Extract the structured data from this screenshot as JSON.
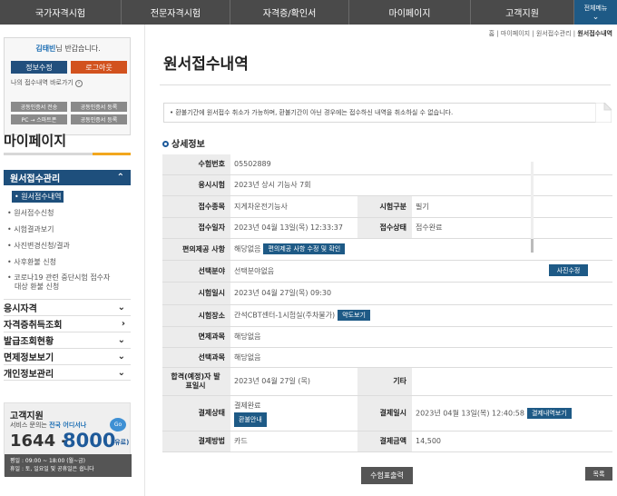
{
  "topnav": {
    "tabs": [
      "국가자격시험",
      "전문자격시험",
      "자격증/확인서",
      "마이페이지",
      "고객지원"
    ],
    "all_menu": "전체메뉴"
  },
  "user": {
    "name": "김태빈",
    "greeting_suffix": "님 반갑습니다.",
    "info_button": "정보수정",
    "logout_button": "로그아웃",
    "quick_link": "나의 접수내역 바로가기",
    "cert_buttons": [
      "공동인증서 전송",
      "공동인증서 등록",
      "PC → 스마트폰",
      "공동인증서 등록"
    ]
  },
  "sidebar": {
    "title": "마이페이지",
    "section": "원서접수관리",
    "subitems": [
      "원서접수내역",
      "원서접수신청",
      "시험결과보기",
      "사진변경신청/결과",
      "사후환불 신청"
    ],
    "corona_line1": "코로나19 관련 중단시험 접수자",
    "corona_line2": "대상 환불 신청",
    "menus": [
      "응시자격",
      "자격증취득조회",
      "발급조회현황",
      "면제정보보기",
      "개인정보관리"
    ]
  },
  "support": {
    "title": "고객지원",
    "sub_prefix": "서비스 문의는 ",
    "sub_hl": "전국 어디서나",
    "bubble": "Go",
    "phone1": "1644 -",
    "phone2": "8000",
    "phone3": "(유료)",
    "hours1": "평일 : 09:00 ~ 18:00 (월~금)",
    "hours2": "휴일 : 토, 일요일 및 공휴일은 쉽니다"
  },
  "breadcrumb": {
    "path": "홈 | 마이페이지 | 원서접수관리 | ",
    "current": "원서접수내역"
  },
  "page_title": "원서접수내역",
  "notice": "• 환불기간에 원서접수 취소가 가능하며, 환불기간이 아닌 경우에는 접수하신 내역을 취소하실 수 없습니다.",
  "section_title": "상세정보",
  "detail": {
    "exam_no_label": "수험번호",
    "exam_no": "05502889",
    "exam_label": "응시시험",
    "exam": "2023년 상시 기능사 7회",
    "item_label": "접수종목",
    "item": "지게차운전기능사",
    "type_label": "시험구분",
    "type": "필기",
    "date_label": "접수일자",
    "date": "2023년 04월 13일(목) 12:33:37",
    "status_label": "접수상태",
    "status": "접수완료",
    "conv_label": "편의제공 사항",
    "conv": "해당없음",
    "conv_button": "편의제공 사항 수정 및 확인",
    "field_label": "선택분야",
    "field": "선택분야없음",
    "photo_button": "사진수정",
    "time_label": "시험일시",
    "time": "2023년 04월 27일(목) 09:30",
    "place_label": "시험장소",
    "place": "간석CBT센터-1시험실(주차불가)",
    "map_button": "약도보기",
    "exempt_label": "면제과목",
    "exempt": "해당없음",
    "subj_label": "선택과목",
    "subj": "해당없음",
    "pass_label_1": "합격(예정)자 발",
    "pass_label_2": "표일시",
    "pass": "2023년 04월 27일 (목)",
    "etc_label": "기타",
    "etc": "",
    "pay_status_label": "결제상태",
    "pay_status": "결제완료",
    "receipt_button": "환불안내",
    "pay_date_label": "결제일시",
    "pay_date": "2023년 04월 13일(목) 12:40:58",
    "pay_detail_button": "결제내역보기",
    "pay_method_label": "결제방법",
    "pay_method": "카드",
    "pay_amount_label": "결제금액",
    "pay_amount": "14,500"
  },
  "buttons": {
    "print": "수험표출력",
    "list": "목록"
  }
}
